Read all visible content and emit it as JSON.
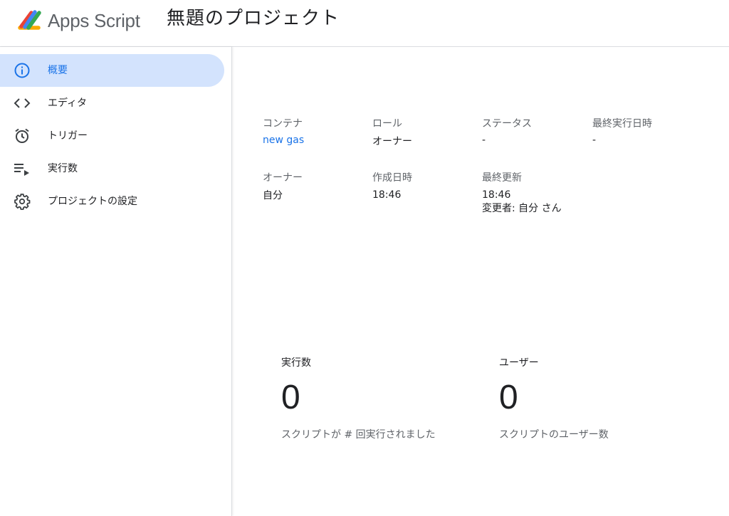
{
  "header": {
    "app_name": "Apps Script",
    "project_title": "無題のプロジェクト"
  },
  "sidebar": {
    "items": [
      {
        "label": "概要",
        "icon": "info-icon",
        "active": true
      },
      {
        "label": "エディタ",
        "icon": "code-icon",
        "active": false
      },
      {
        "label": "トリガー",
        "icon": "alarm-icon",
        "active": false
      },
      {
        "label": "実行数",
        "icon": "playlist-play-icon",
        "active": false
      },
      {
        "label": "プロジェクトの設定",
        "icon": "gear-icon",
        "active": false
      }
    ]
  },
  "overview": {
    "container": {
      "label": "コンテナ",
      "value": "new gas"
    },
    "role": {
      "label": "ロール",
      "value": "オーナー"
    },
    "status": {
      "label": "ステータス",
      "value": "-"
    },
    "last_run": {
      "label": "最終実行日時",
      "value": "-"
    },
    "owner": {
      "label": "オーナー",
      "value": "自分"
    },
    "created": {
      "label": "作成日時",
      "value": "18:46"
    },
    "modified": {
      "label": "最終更新",
      "value": "18:46",
      "by": "変更者: 自分 さん"
    }
  },
  "stats": {
    "executions": {
      "label": "実行数",
      "value": "0",
      "desc": "スクリプトが # 回実行されました"
    },
    "users": {
      "label": "ユーザー",
      "value": "0",
      "desc": "スクリプトのユーザー数"
    }
  },
  "colors": {
    "accent": "#1a73e8",
    "active_bg": "#d3e3fd",
    "muted_text": "#5f6368"
  }
}
